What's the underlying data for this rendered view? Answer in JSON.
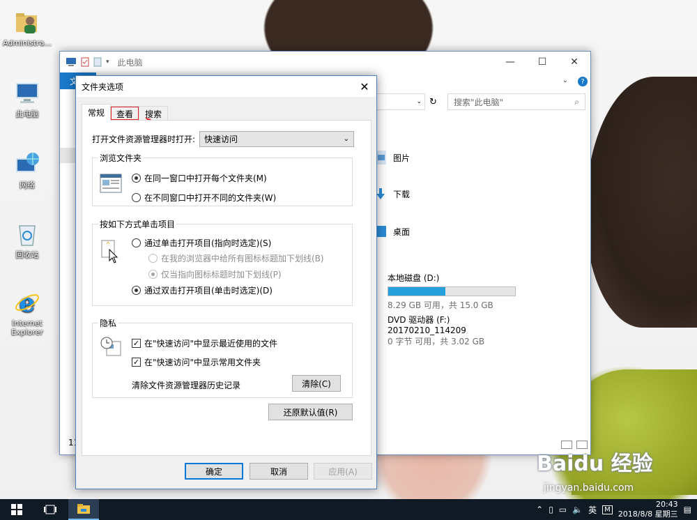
{
  "desktop": {
    "icons": [
      {
        "label": "Administra...",
        "icon": "user-folder-icon"
      },
      {
        "label": "此电脑",
        "icon": "computer-icon"
      },
      {
        "label": "网络",
        "icon": "network-icon"
      },
      {
        "label": "回收站",
        "icon": "recycle-bin-icon"
      },
      {
        "label": "Internet Explorer",
        "icon": "ie-icon"
      }
    ]
  },
  "explorer": {
    "title": "此电脑",
    "file_tab": "文件",
    "search_placeholder": "搜索\"此电脑\"",
    "folders": [
      "图片",
      "下载",
      "桌面"
    ],
    "drives": [
      {
        "name": "本地磁盘 (D:)",
        "info": "8.29 GB 可用，共 15.0 GB",
        "used_fraction": 0.45
      },
      {
        "name": "DVD 驱动器 (F:)",
        "label": "20170210_114209",
        "info": "0 字节 可用，共 3.02 GB"
      }
    ],
    "status": "11"
  },
  "dialog": {
    "title": "文件夹选项",
    "tabs": [
      "常规",
      "查看",
      "搜索"
    ],
    "open_label": "打开文件资源管理器时打开:",
    "open_value": "快速访问",
    "browse_group": {
      "legend": "浏览文件夹",
      "opt_same": "在同一窗口中打开每个文件夹(M)",
      "opt_new": "在不同窗口中打开不同的文件夹(W)"
    },
    "click_group": {
      "legend": "按如下方式单击项目",
      "opt_single": "通过单击打开项目(指向时选定)(S)",
      "opt_browser": "在我的浏览器中给所有图标标题加下划线(B)",
      "opt_point": "仅当指向图标标题时加下划线(P)",
      "opt_double": "通过双击打开项目(单击时选定)(D)"
    },
    "privacy_group": {
      "legend": "隐私",
      "recent_files": "在\"快速访问\"中显示最近使用的文件",
      "frequent_folders": "在\"快速访问\"中显示常用文件夹",
      "clear_label": "清除文件资源管理器历史记录",
      "clear_button": "清除(C)"
    },
    "restore_button": "还原默认值(R)",
    "ok_button": "确定",
    "cancel_button": "取消",
    "apply_button": "应用(A)"
  },
  "taskbar": {
    "ime": "英",
    "time": "20:43",
    "date": "2018/8/8 星期三"
  },
  "watermark": {
    "brand": "Baidu 经验",
    "url": "jingyan.baidu.com"
  }
}
